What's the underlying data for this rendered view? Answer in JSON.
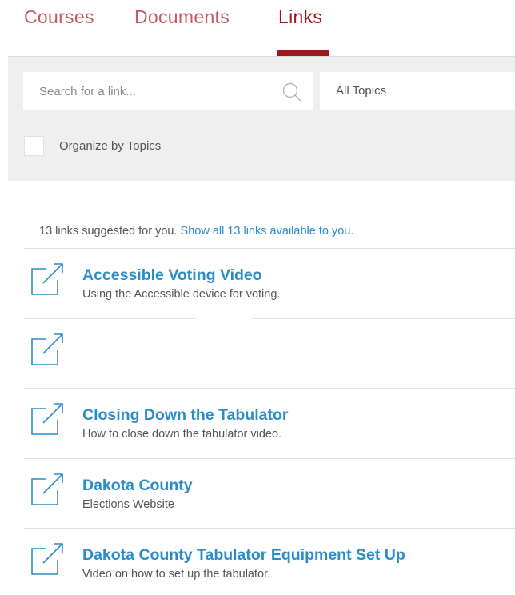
{
  "tabs": [
    {
      "label": "Courses",
      "active": false
    },
    {
      "label": "Documents",
      "active": false
    },
    {
      "label": "Links",
      "active": true
    }
  ],
  "filters": {
    "search_placeholder": "Search for a link...",
    "topic_selected": "All Topics",
    "organize_label": "Organize by Topics",
    "organize_checked": false
  },
  "summary": {
    "text": "13 links suggested for you.",
    "show_all_link": "Show all 13 links available to you."
  },
  "links": [
    {
      "title": "Accessible Voting Video",
      "description": "Using the Accessible device for voting.",
      "icon": "external-link-icon"
    },
    {
      "title": "",
      "description": "",
      "icon": "external-link-icon"
    },
    {
      "title": "Closing Down the Tabulator",
      "description": "How to close down the tabulator video.",
      "icon": "external-link-icon"
    },
    {
      "title": "Dakota County",
      "description": "Elections Website",
      "icon": "external-link-icon"
    },
    {
      "title": "Dakota County Tabulator Equipment Set Up",
      "description": "Video on how to set up the tabulator.",
      "icon": "external-link-icon"
    }
  ],
  "colors": {
    "tab_active": "#a4161f",
    "tab_inactive": "#c65a63",
    "link_blue": "#2a8cc8",
    "panel_bg": "#efefef"
  }
}
